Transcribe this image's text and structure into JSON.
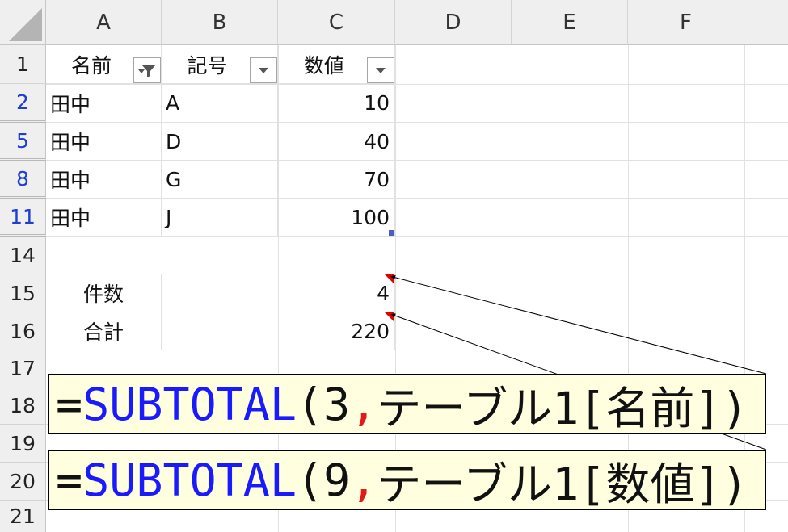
{
  "columns": [
    "A",
    "B",
    "C",
    "D",
    "E",
    "F"
  ],
  "rows": [
    "1",
    "2",
    "5",
    "8",
    "11",
    "14",
    "15",
    "16",
    "17",
    "18",
    "19",
    "20",
    "21"
  ],
  "header_row": {
    "a": "名前",
    "b": "記号",
    "c": "数値"
  },
  "data_rows": [
    {
      "row": "2",
      "a": "田中",
      "b": "A",
      "c": "10"
    },
    {
      "row": "5",
      "a": "田中",
      "b": "D",
      "c": "40"
    },
    {
      "row": "8",
      "a": "田中",
      "b": "G",
      "c": "70"
    },
    {
      "row": "11",
      "a": "田中",
      "b": "J",
      "c": "100"
    }
  ],
  "summary": {
    "count_label": "件数",
    "count_value": "4",
    "sum_label": "合計",
    "sum_value": "220"
  },
  "formulas": [
    {
      "eq": "=",
      "fn": "SUBTOTAL",
      "open": "(",
      "arg": "3",
      "comma": ",",
      "ref": " テーブル1[名前])"
    },
    {
      "eq": "=",
      "fn": "SUBTOTAL",
      "open": "(",
      "arg": "9",
      "comma": ",",
      "ref": " テーブル1[数値])"
    }
  ],
  "colors": {
    "filtered_row_header": "#1f3fd0",
    "formula_function": "#1a1aff",
    "formula_comma": "#e21a1a",
    "comment_indicator": "#e00000",
    "formula_box_bg": "#ffffe0"
  },
  "icons": {
    "filter_active": "funnel-with-arrow-icon",
    "filter_dropdown": "chevron-down-icon",
    "comment_marker": "red-triangle-icon"
  }
}
